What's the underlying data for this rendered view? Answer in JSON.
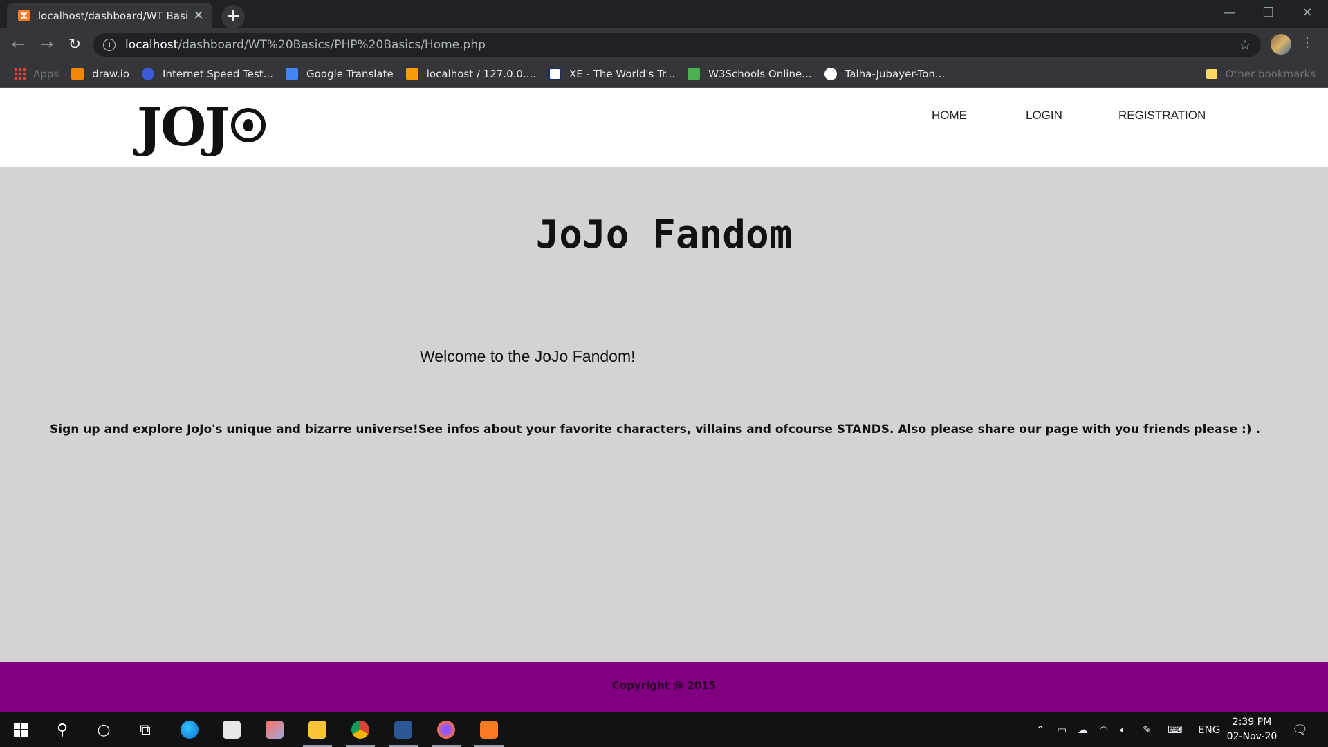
{
  "browser": {
    "tab_title": "localhost/dashboard/WT Basics/",
    "url_host": "localhost",
    "url_path": "/dashboard/WT%20Basics/PHP%20Basics/Home.php",
    "bookmarks": [
      {
        "label": "Apps",
        "color": "#ea4335"
      },
      {
        "label": "draw.io",
        "color": "#f08705"
      },
      {
        "label": "Internet Speed Test...",
        "color": "#3b5bdb"
      },
      {
        "label": "Google Translate",
        "color": "#4285f4"
      },
      {
        "label": "localhost / 127.0.0....",
        "color": "#f89c0e"
      },
      {
        "label": "XE - The World's Tr...",
        "color": "#1a2b6b"
      },
      {
        "label": "W3Schools Online...",
        "color": "#4caf50"
      },
      {
        "label": "Talha-Jubayer-Ton...",
        "color": "#ffffff"
      }
    ],
    "other_bookmarks": "Other bookmarks"
  },
  "site": {
    "logo_text": "JOJ",
    "nav": {
      "home": "HOME",
      "login": "LOGIN",
      "registration": "REGISTRATION"
    },
    "hero_title": "JoJo Fandom",
    "welcome": "Welcome to the JoJo Fandom!",
    "intro": "Sign up and explore JoJo's unique and bizarre universe!See infos about your favorite characters, villains and ofcourse STANDS. Also please share our page with you friends please :) .",
    "copyright": "Copyright @ 2015",
    "footer_color": "#800080"
  },
  "taskbar": {
    "language": "ENG",
    "time": "2:39 PM",
    "date": "02-Nov-20"
  }
}
